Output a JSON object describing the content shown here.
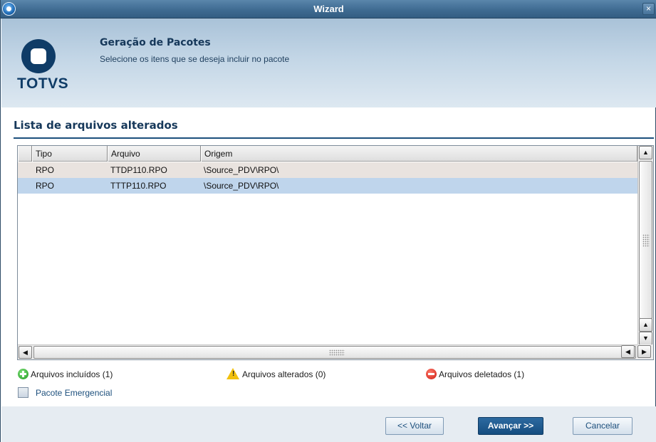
{
  "window": {
    "title": "Wizard",
    "close_label": "×"
  },
  "header": {
    "logo_text": "TOTVS",
    "title": "Geração de Pacotes",
    "subtitle": "Selecione os itens que se deseja incluir no pacote"
  },
  "section": {
    "title": "Lista de arquivos alterados"
  },
  "table": {
    "columns": [
      "Tipo",
      "Arquivo",
      "Origem"
    ],
    "rows": [
      {
        "tipo": "RPO",
        "arquivo": "TTDP110.RPO",
        "origem": "\\Source_PDV\\RPO\\",
        "selected": false
      },
      {
        "tipo": "RPO",
        "arquivo": "TTTP110.RPO",
        "origem": "\\Source_PDV\\RPO\\",
        "selected": true
      }
    ]
  },
  "legend": {
    "included": "Arquivos incluídos (1)",
    "changed": "Arquivos alterados (0)",
    "deleted": "Arquivos deletados (1)"
  },
  "emergency": {
    "label": "Pacote Emergencial",
    "checked": false
  },
  "buttons": {
    "back": "<< Voltar",
    "next": "Avançar >>",
    "cancel": "Cancelar"
  },
  "icons": {
    "included": "plus-circle-icon",
    "changed": "warning-icon",
    "deleted": "minus-circle-icon"
  },
  "colors": {
    "accent": "#1c4f7c",
    "selected_row": "#bfd5ec",
    "primary_button": "#154d80"
  }
}
